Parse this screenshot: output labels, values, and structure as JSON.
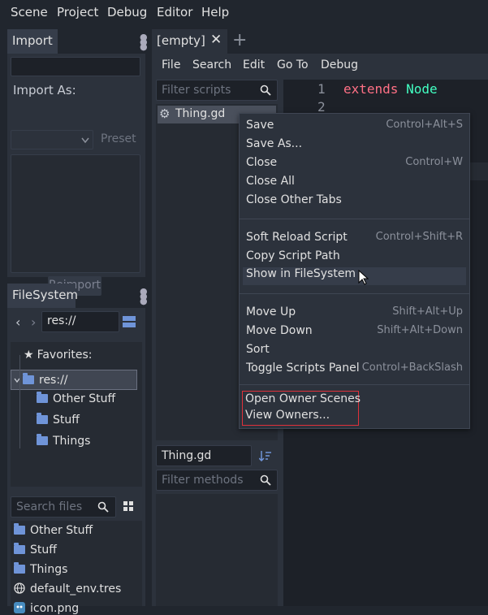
{
  "menubar": {
    "items": [
      "Scene",
      "Project",
      "Debug",
      "Editor",
      "Help"
    ]
  },
  "import_panel": {
    "tab": "Import",
    "import_as_label": "Import As:",
    "preset_label": "Preset",
    "reimport_label": "Reimport"
  },
  "filesystem": {
    "tab": "FileSystem",
    "path": "res://",
    "favorites_label": "Favorites:",
    "tree": {
      "root": "res://",
      "folders": [
        "Other Stuff",
        "Stuff",
        "Things"
      ]
    },
    "search_placeholder": "Search files",
    "files": [
      {
        "name": "Other Stuff",
        "icon": "folder-icon"
      },
      {
        "name": "Stuff",
        "icon": "folder-icon"
      },
      {
        "name": "Things",
        "icon": "folder-icon"
      },
      {
        "name": "default_env.tres",
        "icon": "globe-icon"
      },
      {
        "name": "icon.png",
        "icon": "image-icon"
      }
    ]
  },
  "editor": {
    "tab_label": "[empty]",
    "menu": [
      "File",
      "Search",
      "Edit",
      "Go To",
      "Debug"
    ],
    "filter_scripts_placeholder": "Filter scripts",
    "script_item": "Thing.gd",
    "current_script": "Thing.gd",
    "filter_methods_placeholder": "Filter methods",
    "code_lines": [
      {
        "num": "1",
        "keyword": "extends",
        "type": "Node"
      },
      {
        "num": "2"
      }
    ]
  },
  "context_menu": {
    "groups": [
      [
        {
          "label": "Save",
          "shortcut": "Control+Alt+S"
        },
        {
          "label": "Save As...",
          "shortcut": ""
        },
        {
          "label": "Close",
          "shortcut": "Control+W"
        },
        {
          "label": "Close All",
          "shortcut": ""
        },
        {
          "label": "Close Other Tabs",
          "shortcut": ""
        }
      ],
      [
        {
          "label": "Soft Reload Script",
          "shortcut": "Control+Shift+R"
        },
        {
          "label": "Copy Script Path",
          "shortcut": ""
        },
        {
          "label": "Show in FileSystem",
          "shortcut": ""
        }
      ],
      [
        {
          "label": "Move Up",
          "shortcut": "Shift+Alt+Up"
        },
        {
          "label": "Move Down",
          "shortcut": "Shift+Alt+Down"
        },
        {
          "label": "Sort",
          "shortcut": ""
        },
        {
          "label": "Toggle Scripts Panel",
          "shortcut": "Control+BackSlash"
        }
      ],
      [
        {
          "label": "Open Owner Scenes",
          "shortcut": ""
        },
        {
          "label": "View Owners...",
          "shortcut": ""
        }
      ]
    ]
  },
  "colors": {
    "accent": "#6f94d8",
    "keyword": "#ff7085",
    "type": "#42ffc2",
    "highlight_box": "#e0313a"
  }
}
